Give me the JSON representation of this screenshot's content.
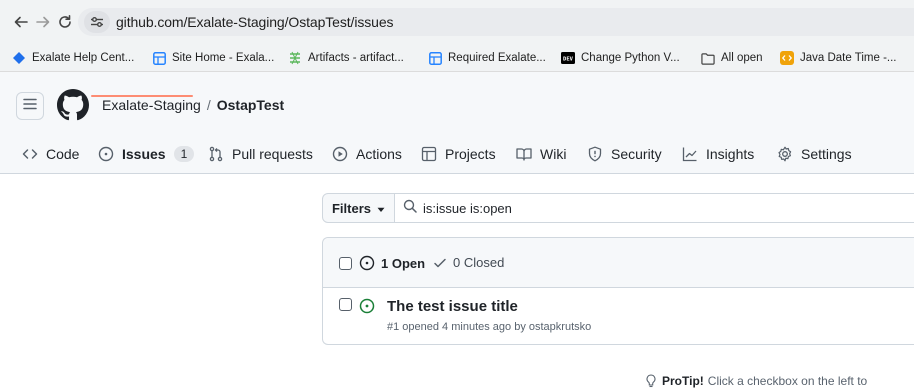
{
  "browser": {
    "url": "github.com/Exalate-Staging/OstapTest/issues",
    "back_icon": "arrow-left-icon",
    "forward_icon": "arrow-right-icon",
    "reload_icon": "reload-icon",
    "site_info_icon": "site-info-icon"
  },
  "bookmarks": [
    {
      "label": "Exalate Help Cent...",
      "icon": "exalate-diamond-icon",
      "color": "#1f6feb"
    },
    {
      "label": "Site Home - Exala...",
      "icon": "confluence-table-icon",
      "color": "#2684ff"
    },
    {
      "label": "Artifacts - artifact...",
      "icon": "artifacts-icon",
      "color": "#5cb85c"
    },
    {
      "label": "Required Exalate...",
      "icon": "confluence-table-icon",
      "color": "#2684ff"
    },
    {
      "label": "Change Python V...",
      "icon": "dev-icon",
      "color": "#000000"
    },
    {
      "label": "All open",
      "icon": "folder-icon",
      "color": "#444444"
    },
    {
      "label": "Java Date Time -...",
      "icon": "code-badge-icon",
      "color": "#f0a30a"
    }
  ],
  "repo": {
    "owner": "Exalate-Staging",
    "separator": "/",
    "name": "OstapTest"
  },
  "tabs": [
    {
      "label": "Code",
      "icon": "code-icon"
    },
    {
      "label": "Issues",
      "icon": "issue-opened-icon",
      "counter": "1",
      "active": true
    },
    {
      "label": "Pull requests",
      "icon": "git-pull-request-icon"
    },
    {
      "label": "Actions",
      "icon": "play-icon"
    },
    {
      "label": "Projects",
      "icon": "table-icon"
    },
    {
      "label": "Wiki",
      "icon": "book-icon"
    },
    {
      "label": "Security",
      "icon": "shield-icon"
    },
    {
      "label": "Insights",
      "icon": "graph-icon"
    },
    {
      "label": "Settings",
      "icon": "gear-icon"
    }
  ],
  "filters": {
    "button_label": "Filters",
    "query": "is:issue is:open"
  },
  "issues_header": {
    "open_label": "1 Open",
    "closed_label": "0 Closed"
  },
  "issues": [
    {
      "title": "The test issue title",
      "meta": "#1 opened 4 minutes ago by ostapkrutsko"
    }
  ],
  "protip": {
    "label": "ProTip!",
    "text": "Click a checkbox on the left to"
  },
  "colors": {
    "open_green": "#1a7f37",
    "active_tab_underline": "#fd8c73",
    "border": "#d0d7de"
  }
}
